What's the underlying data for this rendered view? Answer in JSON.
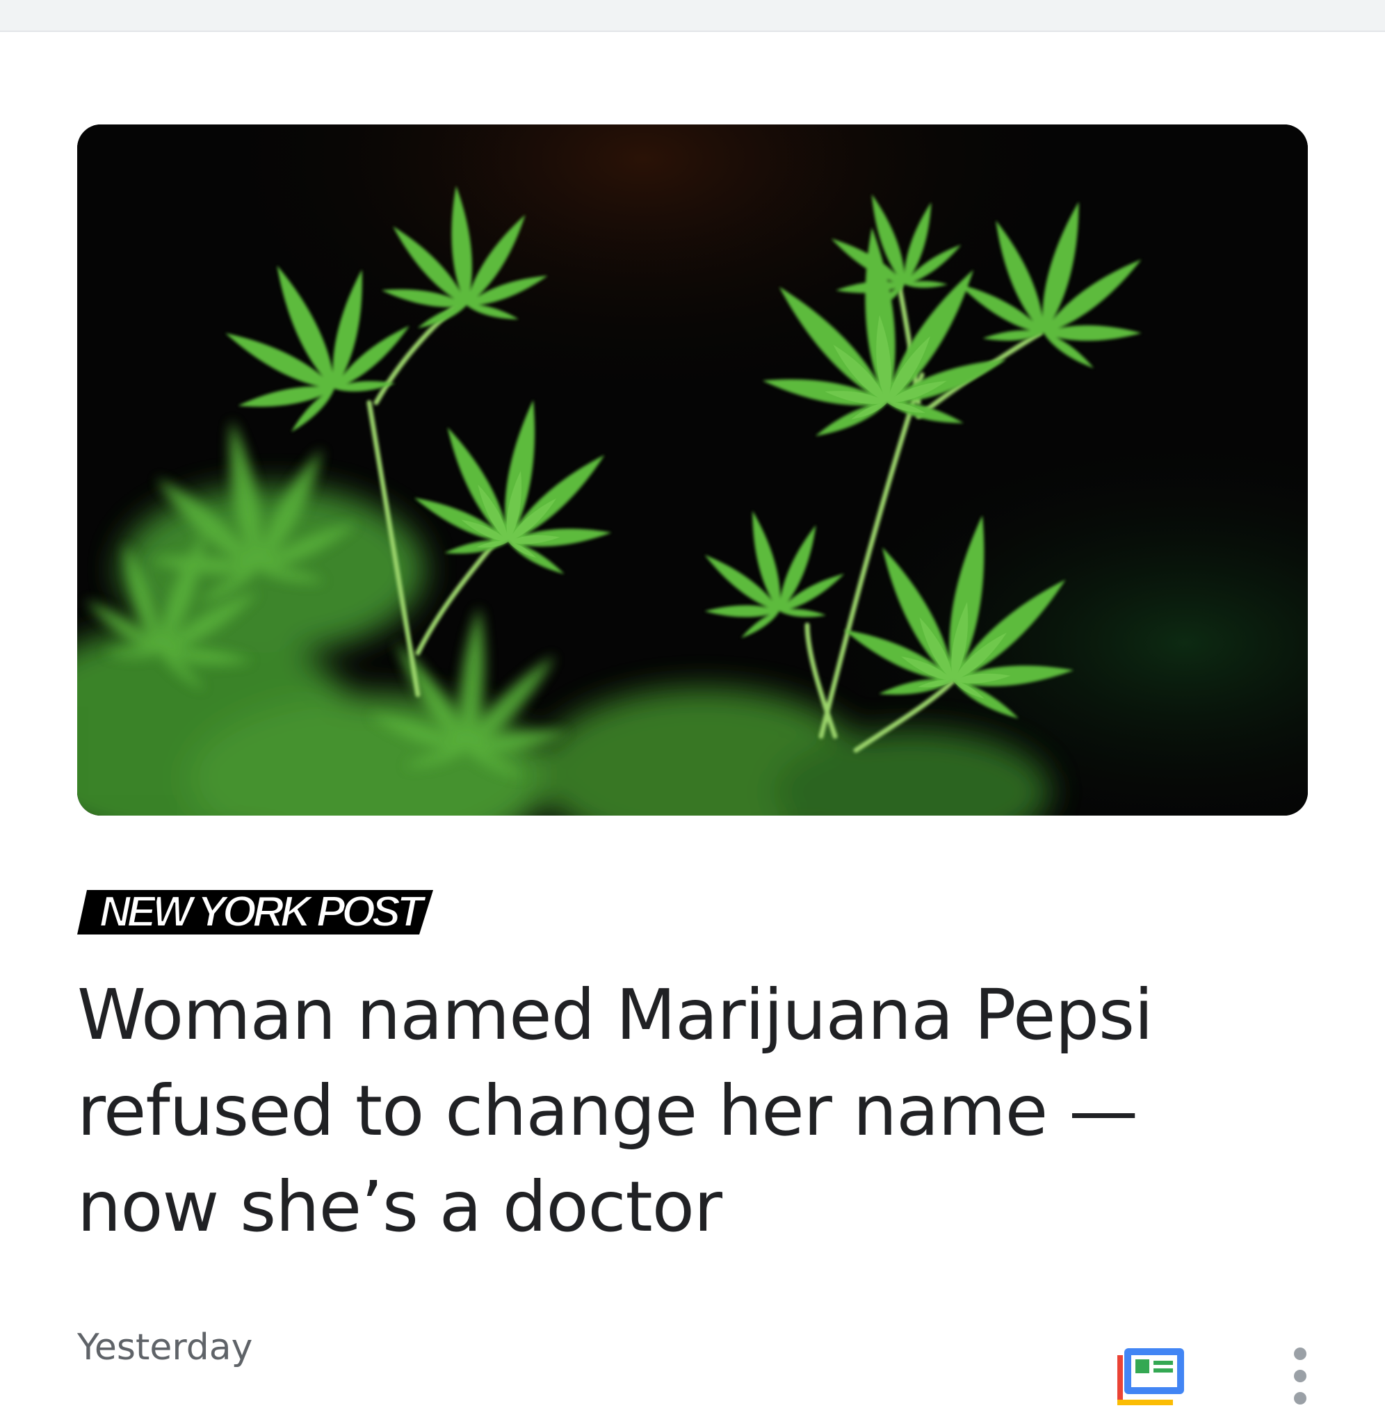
{
  "article": {
    "image_alt": "Close-up photo of green cannabis plant leaves against a dark background",
    "publisher": {
      "logo_text": "NEW YORK POST"
    },
    "headline": "Woman named Marijuana Pepsi refused to change her name — now she’s a doctor",
    "timestamp": "Yesterday"
  },
  "actions": {
    "full_coverage_icon": "newspaper-icon",
    "more_icon": "more-vert-icon"
  },
  "colors": {
    "headline": "#202124",
    "timestamp": "#5f6368",
    "gnews_blue": "#4285f4",
    "gnews_red": "#ea4335",
    "gnews_yellow": "#fbbc04",
    "gnews_green": "#34a853",
    "menu_dots": "#9aa0a6"
  }
}
